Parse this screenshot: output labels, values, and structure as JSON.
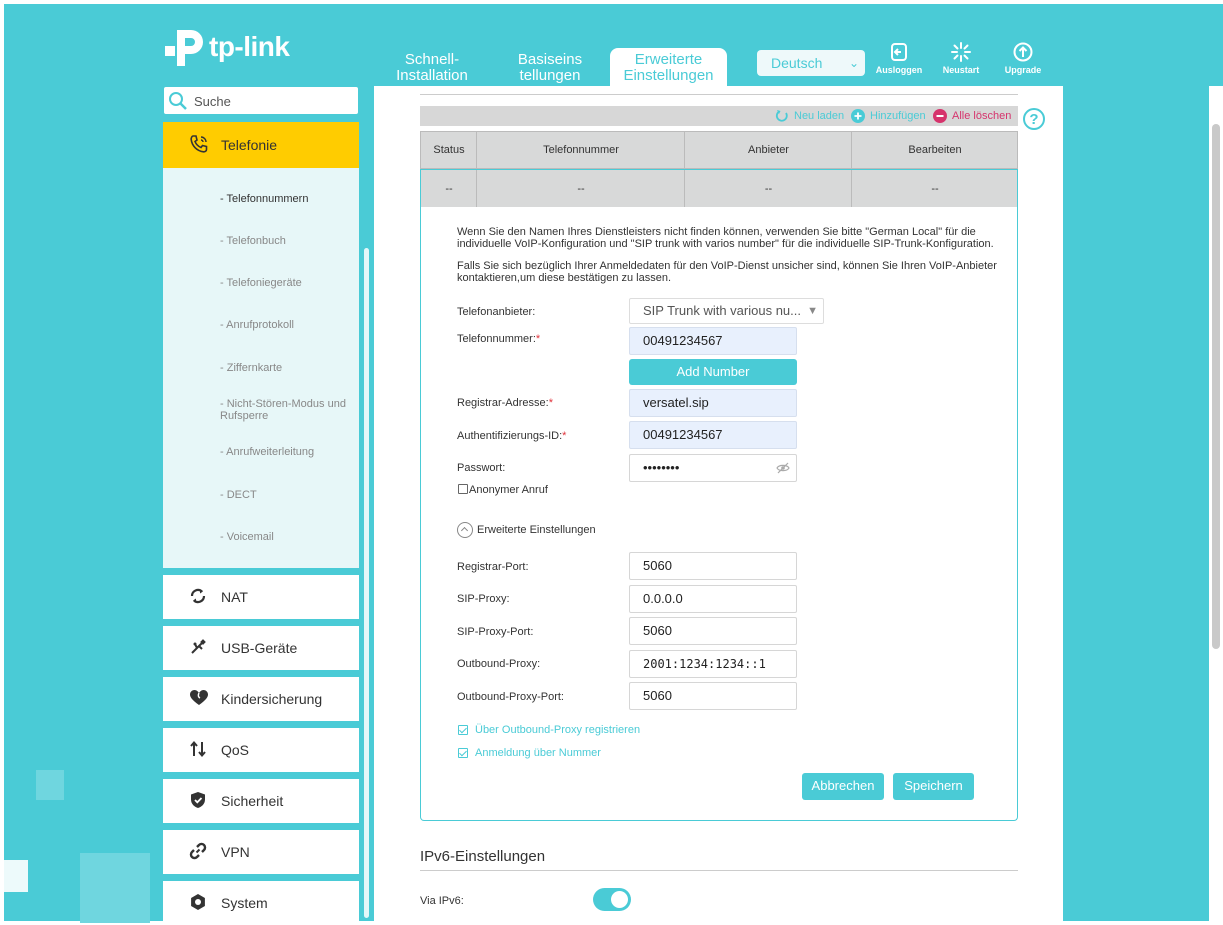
{
  "brand": {
    "name": "tp-link"
  },
  "nav": {
    "tabs": [
      {
        "label_line1": "Schnell-",
        "label_line2": "Installation"
      },
      {
        "label_line1": "Basiseins",
        "label_line2": "tellungen"
      },
      {
        "label_line1": "Erweiterte",
        "label_line2": "Einstellungen"
      }
    ],
    "language": "Deutsch",
    "actions": {
      "logout": "Ausloggen",
      "reboot": "Neustart",
      "upgrade": "Upgrade"
    }
  },
  "sidebar": {
    "search_placeholder": "Suche",
    "active_menu": "Telefonie",
    "submenu": [
      {
        "label": "- Telefonnummern"
      },
      {
        "label": "- Telefonbuch"
      },
      {
        "label": "- Telefoniegeräte"
      },
      {
        "label": "- Anrufprotokoll"
      },
      {
        "label": "- Ziffernkarte"
      },
      {
        "label": "- Nicht-Stören-Modus und Rufsperre"
      },
      {
        "label": "- Anrufweiterleitung"
      },
      {
        "label": "- DECT"
      },
      {
        "label": "- Voicemail"
      }
    ],
    "menu": [
      {
        "label": "NAT"
      },
      {
        "label": "USB-Geräte"
      },
      {
        "label": "Kindersicherung"
      },
      {
        "label": "QoS"
      },
      {
        "label": "Sicherheit"
      },
      {
        "label": "VPN"
      },
      {
        "label": "System"
      }
    ]
  },
  "table": {
    "toolbar": {
      "refresh": "Neu laden",
      "add": "Hinzufügen",
      "delete_all": "Alle löschen"
    },
    "headers": [
      "Status",
      "Telefonnummer",
      "Anbieter",
      "Bearbeiten"
    ],
    "row": [
      "--",
      "--",
      "--",
      "--"
    ]
  },
  "form": {
    "note1": "Wenn Sie den Namen Ihres Dienstleisters nicht finden können, verwenden Sie bitte \"German Local\" für die individuelle VoIP-Konfiguration und \"SIP trunk with varios number\" für die individuelle SIP-Trunk-Konfiguration.",
    "note2": "Falls Sie sich bezüglich Ihrer Anmeldedaten für den VoIP-Dienst unsicher sind, können Sie Ihren VoIP-Anbieter kontaktieren,um diese bestätigen zu lassen.",
    "provider_label": "Telefonanbieter:",
    "provider_value": "SIP Trunk with various nu...",
    "phone_label": "Telefonnummer:",
    "phone_value": "00491234567",
    "add_number": "Add Number",
    "registrar_label": "Registrar-Adresse:",
    "registrar_value": "versatel.sip",
    "auth_label": "Authentifizierungs-ID:",
    "auth_value": "00491234567",
    "password_label": "Passwort:",
    "password_value": "••••••••",
    "anonymous_label": "Anonymer Anruf",
    "advanced_label": "Erweiterte Einstellungen",
    "registrar_port_label": "Registrar-Port:",
    "registrar_port_value": "5060",
    "sip_proxy_label": "SIP-Proxy:",
    "sip_proxy_value": "0.0.0.0",
    "sip_proxy_port_label": "SIP-Proxy-Port:",
    "sip_proxy_port_value": "5060",
    "outbound_proxy_label": "Outbound-Proxy:",
    "outbound_proxy_value": "2001:1234:1234::1",
    "outbound_proxy_port_label": "Outbound-Proxy-Port:",
    "outbound_proxy_port_value": "5060",
    "register_outbound_label": "Über Outbound-Proxy registrieren",
    "login_by_number_label": "Anmeldung über Nummer",
    "cancel": "Abbrechen",
    "save": "Speichern"
  },
  "ipv6": {
    "title": "IPv6-Einstellungen",
    "via_label": "Via IPv6:"
  },
  "colors": {
    "accent": "#4acbd6",
    "active_menu": "#ffcc00",
    "delete": "#d6336c"
  }
}
